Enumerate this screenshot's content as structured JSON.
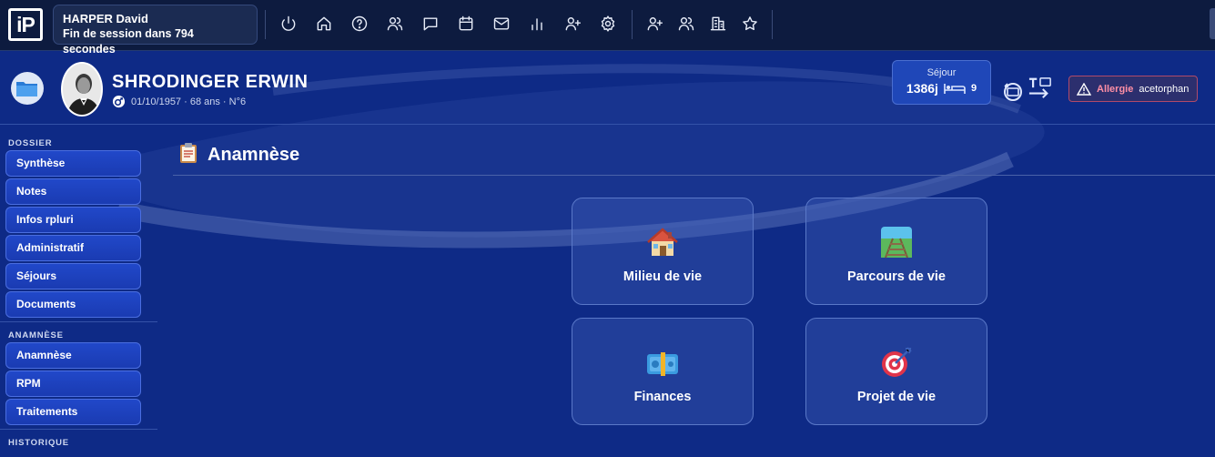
{
  "topbar": {
    "logo_text": "iP",
    "user_name": "HARPER David",
    "session_text": "Fin de session dans 794 secondes",
    "icons": [
      "power-icon",
      "home-icon",
      "help-icon",
      "users-icon",
      "message-icon",
      "calendar-icon",
      "mail-icon",
      "chart-icon",
      "user-add-icon",
      "settings-icon",
      "user-add-icon",
      "users-icon",
      "building-icon",
      "star-icon"
    ]
  },
  "patient": {
    "name": "SHRODINGER ERWIN",
    "info": "01/10/1957 · 68 ans · N°6",
    "sejour_label": "Séjour",
    "sejour_days": "1386j",
    "sejour_beds": "9",
    "allergy_label": "Allergie",
    "allergy_value": "acetorphan"
  },
  "sidebar": {
    "sections": [
      {
        "title": "DOSSIER",
        "items": [
          "Synthèse",
          "Notes",
          "Infos rpluri",
          "Administratif",
          "Séjours",
          "Documents"
        ]
      },
      {
        "title": "ANAMNÈSE",
        "items": [
          "Anamnèse",
          "RPM",
          "Traitements"
        ]
      },
      {
        "title": "HISTORIQUE",
        "items": []
      }
    ]
  },
  "main": {
    "title": "Anamnèse",
    "cards": [
      {
        "label": "Milieu de vie",
        "icon": "house-icon"
      },
      {
        "label": "Parcours de vie",
        "icon": "railway-icon"
      },
      {
        "label": "Finances",
        "icon": "money-icon"
      },
      {
        "label": "Projet de vie",
        "icon": "target-icon"
      }
    ]
  },
  "colors": {
    "background": "#0e2a86",
    "topbar": "#0d1b3f",
    "button": "#1f44c4",
    "allergy": "#ff8fa5"
  }
}
